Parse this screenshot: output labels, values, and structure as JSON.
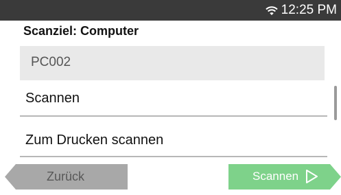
{
  "status_bar": {
    "time": "12:25 PM",
    "wifi_icon": "wifi-icon"
  },
  "title": "Scanziel: Computer",
  "selected_target": "PC002",
  "options": [
    {
      "label": "Scannen"
    },
    {
      "label": "Zum Drucken scannen"
    }
  ],
  "buttons": {
    "back_label": "Zurück",
    "scan_label": "Scannen",
    "scan_icon": "play-outline-icon"
  },
  "colors": {
    "status_bar": "#3a3a3a",
    "selected_bg": "#e9e9e9",
    "back_button": "#a8a8a8",
    "scan_button": "#7ed28a"
  }
}
